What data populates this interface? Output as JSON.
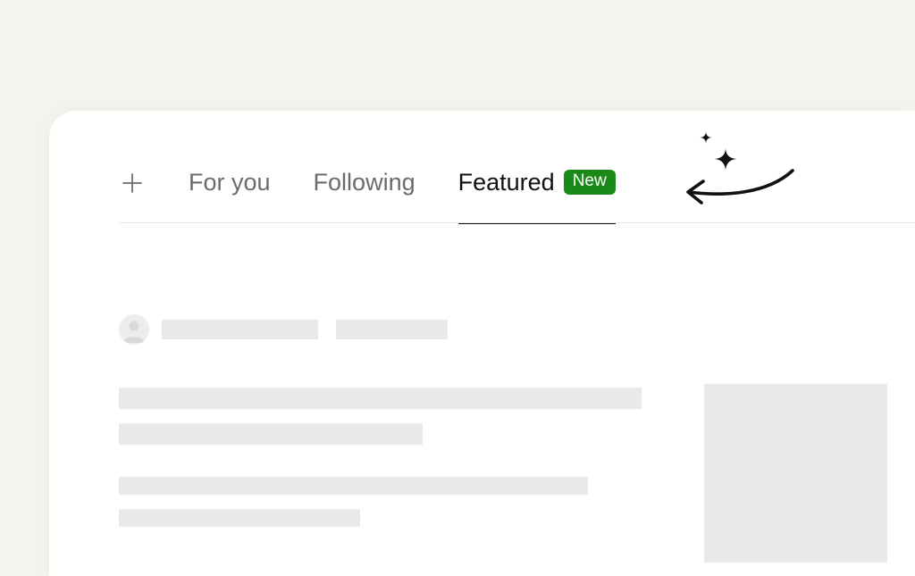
{
  "tabs": {
    "for_you": "For you",
    "following": "Following",
    "featured": "Featured",
    "featured_badge": "New"
  },
  "colors": {
    "badge_bg": "#1a8917",
    "badge_fg": "#ffffff",
    "page_bg": "#f6f4ee",
    "text_active": "#111111",
    "text_inactive": "#6b6b6b"
  }
}
